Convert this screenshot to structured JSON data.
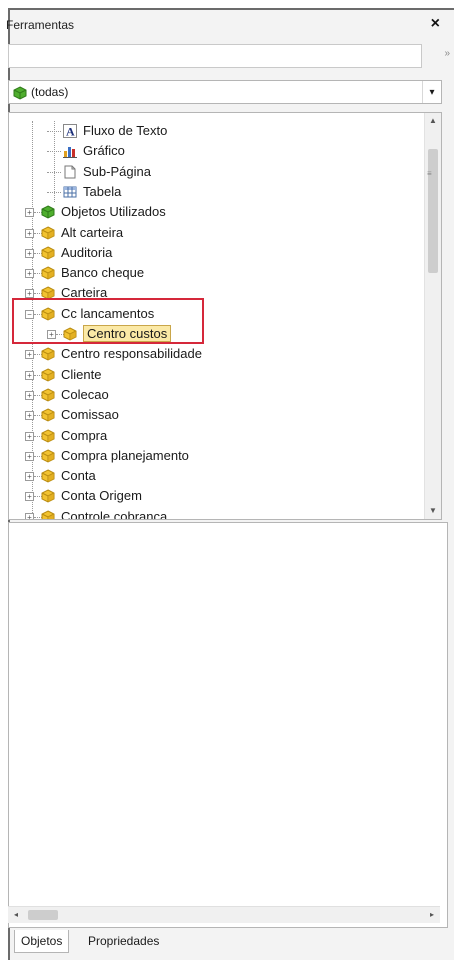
{
  "panel": {
    "title": "Ferramentas",
    "close_glyph": "×"
  },
  "search": {
    "value": "",
    "placeholder": "",
    "go_glyph": "»"
  },
  "filter": {
    "selected": "(todas)",
    "icon": "cube-green-icon",
    "arrow": "▾"
  },
  "tree": {
    "items": [
      {
        "label": "Fluxo de Texto",
        "icon": "text-A-icon",
        "level": 1,
        "expander": ""
      },
      {
        "label": "Gráfico",
        "icon": "chart-icon",
        "level": 1,
        "expander": ""
      },
      {
        "label": "Sub-Página",
        "icon": "page-icon",
        "level": 1,
        "expander": ""
      },
      {
        "label": "Tabela",
        "icon": "table-icon",
        "level": 1,
        "expander": ""
      },
      {
        "label": "Objetos Utilizados",
        "icon": "cube-green-icon",
        "level": 0,
        "expander": "+"
      },
      {
        "label": "Alt carteira",
        "icon": "cube-yellow-icon",
        "level": 0,
        "expander": "+"
      },
      {
        "label": "Auditoria",
        "icon": "cube-yellow-icon",
        "level": 0,
        "expander": "+"
      },
      {
        "label": "Banco cheque",
        "icon": "cube-yellow-icon",
        "level": 0,
        "expander": "+"
      },
      {
        "label": "Carteira",
        "icon": "cube-yellow-icon",
        "level": 0,
        "expander": "+"
      },
      {
        "label": "Cc lancamentos",
        "icon": "cube-yellow-icon",
        "level": 0,
        "expander": "−"
      },
      {
        "label": "Centro custos",
        "icon": "cube-yellow-icon",
        "level": 1,
        "expander": "+",
        "selected": true
      },
      {
        "label": "Centro responsabilidade",
        "icon": "cube-yellow-icon",
        "level": 0,
        "expander": "+"
      },
      {
        "label": "Cliente",
        "icon": "cube-yellow-icon",
        "level": 0,
        "expander": "+"
      },
      {
        "label": "Colecao",
        "icon": "cube-yellow-icon",
        "level": 0,
        "expander": "+"
      },
      {
        "label": "Comissao",
        "icon": "cube-yellow-icon",
        "level": 0,
        "expander": "+"
      },
      {
        "label": "Compra",
        "icon": "cube-yellow-icon",
        "level": 0,
        "expander": "+"
      },
      {
        "label": "Compra planejamento",
        "icon": "cube-yellow-icon",
        "level": 0,
        "expander": "+"
      },
      {
        "label": "Conta",
        "icon": "cube-yellow-icon",
        "level": 0,
        "expander": "+"
      },
      {
        "label": "Conta Origem",
        "icon": "cube-yellow-icon",
        "level": 0,
        "expander": "+"
      },
      {
        "label": "Controle cobranca",
        "icon": "cube-yellow-icon",
        "level": 0,
        "expander": "+"
      }
    ]
  },
  "scroll": {
    "up": "▲",
    "down": "▼",
    "left": "◂",
    "right": "▸",
    "grip": "≡"
  },
  "tabs": [
    {
      "label": "Objetos",
      "active": true
    },
    {
      "label": "Propriedades",
      "active": false
    }
  ],
  "colors": {
    "highlight": "#d5283a",
    "selection": "#fbe9a6",
    "cube_yellow": "#f2c230",
    "cube_green": "#4fae2e"
  }
}
